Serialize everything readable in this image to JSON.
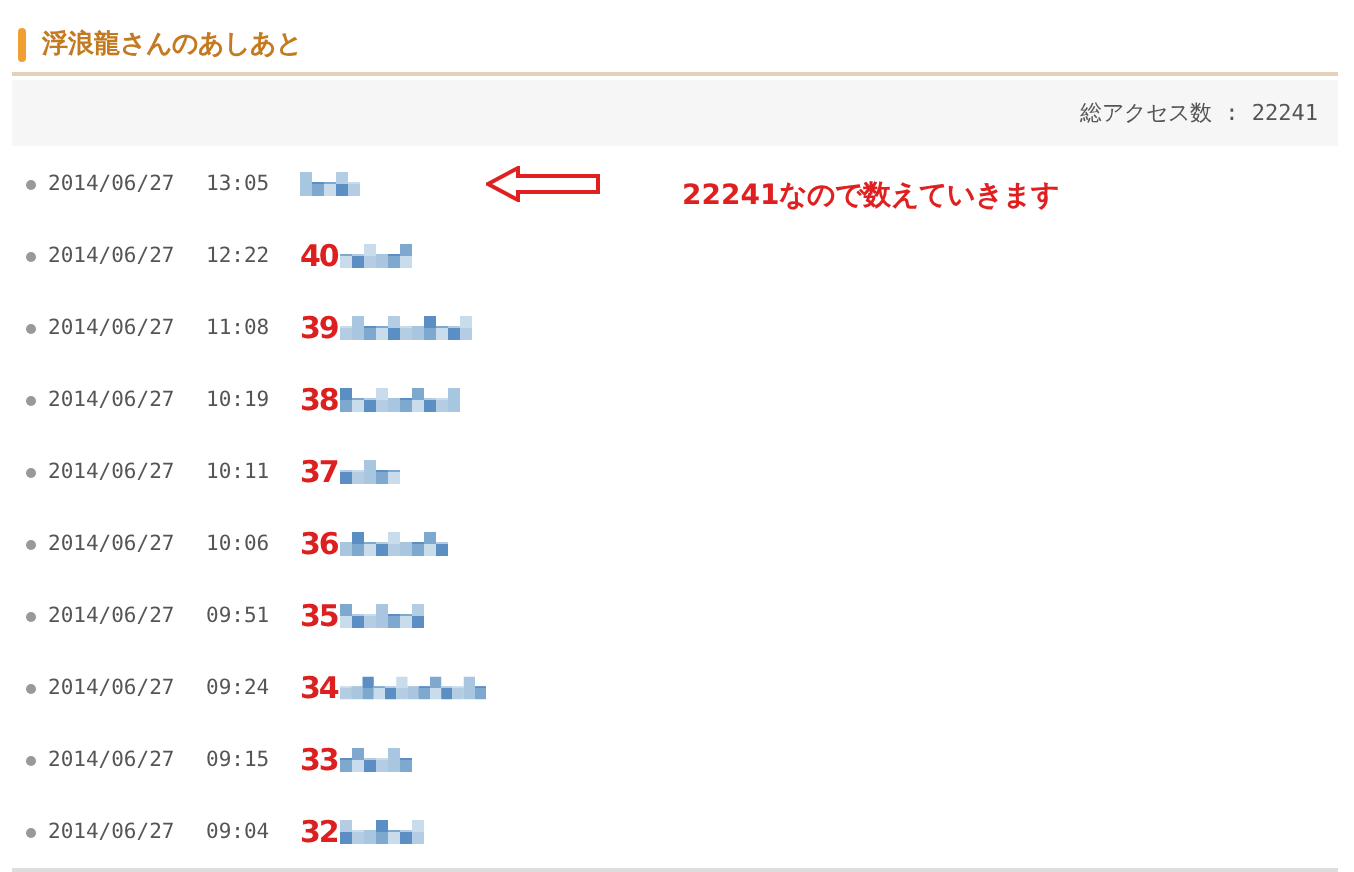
{
  "heading": {
    "title": "浮浪龍さんのあしあと"
  },
  "summary": {
    "total_access": "総アクセス数 : 22241"
  },
  "callout": {
    "note": "22241なので数えていきます"
  },
  "entries": [
    {
      "date": "2014/06/27",
      "time": "13:05"
    },
    {
      "date": "2014/06/27",
      "time": "12:22",
      "annotation": "40"
    },
    {
      "date": "2014/06/27",
      "time": "11:08",
      "annotation": "39"
    },
    {
      "date": "2014/06/27",
      "time": "10:19",
      "annotation": "38"
    },
    {
      "date": "2014/06/27",
      "time": "10:11",
      "annotation": "37"
    },
    {
      "date": "2014/06/27",
      "time": "10:06",
      "annotation": "36"
    },
    {
      "date": "2014/06/27",
      "time": "09:51",
      "annotation": "35"
    },
    {
      "date": "2014/06/27",
      "time": "09:24",
      "annotation": "34"
    },
    {
      "date": "2014/06/27",
      "time": "09:15",
      "annotation": "33"
    },
    {
      "date": "2014/06/27",
      "time": "09:04",
      "annotation": "32"
    }
  ]
}
